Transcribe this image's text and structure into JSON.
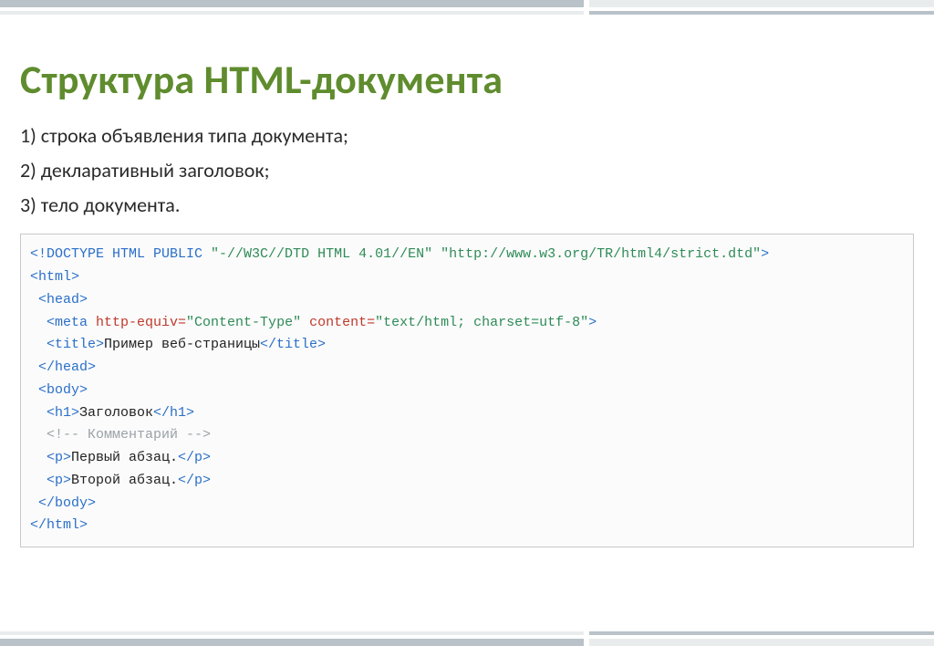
{
  "title": "Структура HTML-документа",
  "bullets": [
    "1) строка объявления типа документа;",
    "2) декларативный заголовок;",
    "3) тело документа."
  ],
  "code": {
    "l1": {
      "doctype": "<!DOCTYPE HTML PUBLIC ",
      "s1": "\"-//W3C//DTD HTML 4.01//EN\"",
      "mid": " ",
      "s2": "\"http://www.w3.org/TR/html4/strict.dtd\"",
      "end": ">"
    },
    "l2": "<html>",
    "l3": " <head>",
    "l4": {
      "open": "  <meta ",
      "attr1": "http-equiv=",
      "val1": "\"Content-Type\"",
      "sp": " ",
      "attr2": "content=",
      "val2": "\"text/html; charset=utf-8\"",
      "close": ">"
    },
    "l5": {
      "open": "  <title>",
      "text": "Пример веб-страницы",
      "close": "</title>"
    },
    "l6": " </head>",
    "l7": " <body>",
    "l8": {
      "open": "  <h1>",
      "text": "Заголовок",
      "close": "</h1>"
    },
    "l9": "  <!-- Комментарий -->",
    "l10": {
      "open": "  <p>",
      "text": "Первый абзац.",
      "close": "</p>"
    },
    "l11": {
      "open": "  <p>",
      "text": "Второй абзац.",
      "close": "</p>"
    },
    "l12": " </body>",
    "l13": "</html>"
  }
}
